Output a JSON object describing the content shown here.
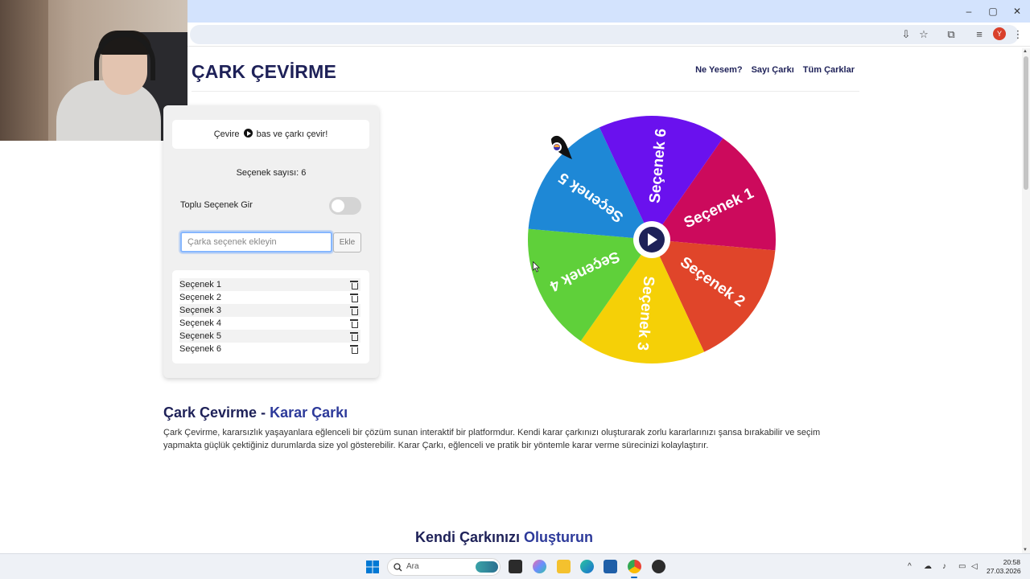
{
  "browser": {
    "window_controls": {
      "minimize": "–",
      "maximize": "▢",
      "close": "✕"
    },
    "profile_initial": "Y"
  },
  "site": {
    "logo": "ÇARK ÇEVİRME",
    "nav": [
      "Ne Yesem?",
      "Sayı Çarkı",
      "Tüm Çarklar"
    ]
  },
  "panel": {
    "hint_prefix": "Çevire",
    "hint_suffix": "bas ve çarkı çevir!",
    "option_count": "Seçenek sayısı: 6",
    "bulk_label": "Toplu Seçenek Gir",
    "bulk_enabled": false,
    "input_placeholder": "Çarka seçenek ekleyin",
    "input_value": "",
    "add_label": "Ekle",
    "options": [
      "Seçenek 1",
      "Seçenek 2",
      "Seçenek 3",
      "Seçenek 4",
      "Seçenek 5",
      "Seçenek 6"
    ]
  },
  "wheel": {
    "segments": [
      {
        "label": "Seçenek 1",
        "color": "#cc0a5c"
      },
      {
        "label": "Seçenek 2",
        "color": "#e0452a"
      },
      {
        "label": "Seçenek 3",
        "color": "#f5d007"
      },
      {
        "label": "Seçenek 4",
        "color": "#5fd03a"
      },
      {
        "label": "Seçenek 5",
        "color": "#1e88d6"
      },
      {
        "label": "Seçenek 6",
        "color": "#6a11ee"
      }
    ],
    "center_color": "#1e2158"
  },
  "about": {
    "title_part1": "Çark Çevirme - ",
    "title_part2": "Karar Çarkı",
    "text": "Çark Çevirme, kararsızlık yaşayanlara eğlenceli bir çözüm sunan interaktif bir platformdur. Kendi karar çarkınızı oluşturarak zorlu kararlarınızı şansa bırakabilir ve seçim yapmakta güçlük çektiğiniz durumlarda size yol gösterebilir. Karar Çarkı, eğlenceli ve pratik bir yöntemle karar verme sürecinizi kolaylaştırır."
  },
  "section2": {
    "title_part1": "Kendi Çarkınızı ",
    "title_part2": "Oluşturun"
  },
  "taskbar": {
    "search_label": "Ara",
    "time": "20:58",
    "date": "27.03.2026"
  },
  "colors": {
    "brand": "#1e2158",
    "accent": "#2d3a9a"
  }
}
